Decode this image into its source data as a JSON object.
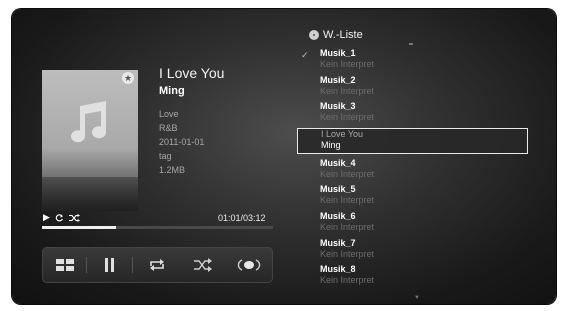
{
  "now_playing": {
    "title": "I Love You",
    "artist": "Ming",
    "album": "Love",
    "genre": "R&B",
    "date": "2011-01-01",
    "tag": "tag",
    "size": "1.2MB",
    "time": "01:01/03:12",
    "progress": 0.32
  },
  "playlist": {
    "title": "W.-Liste",
    "items": [
      {
        "title": "Musik_1",
        "sub": "Kein Interpret",
        "selected": false,
        "playing": true
      },
      {
        "title": "Musik_2",
        "sub": "Kein Interpret",
        "selected": false
      },
      {
        "title": "Musik_3",
        "sub": "Kein Interpret",
        "selected": false
      },
      {
        "title": "I Love You",
        "sub": "Ming",
        "selected": true
      },
      {
        "title": "Musik_4",
        "sub": "Kein Interpret",
        "selected": false
      },
      {
        "title": "Musik_5",
        "sub": "Kein Interpret",
        "selected": false
      },
      {
        "title": "Musik_6",
        "sub": "Kein Interpret",
        "selected": false
      },
      {
        "title": "Musik_7",
        "sub": "Kein Interpret",
        "selected": false
      },
      {
        "title": "Musik_8",
        "sub": "Kein Interpret",
        "selected": false
      }
    ]
  },
  "icons": {
    "play": "play-icon",
    "repeat": "repeat-icon",
    "shuffle": "shuffle-icon",
    "grid": "grid-icon",
    "pause": "pause-icon",
    "surround": "surround-icon",
    "favorite": "star-icon",
    "music_note": "music-note-icon",
    "playlist": "disc-icon",
    "check": "check-icon"
  },
  "colors": {
    "background": "#2f2f2f",
    "text_primary": "#ffffff",
    "text_secondary": "#a8a8a8",
    "text_muted": "#6d6d6d",
    "highlight_border": "#e8e8e8"
  }
}
